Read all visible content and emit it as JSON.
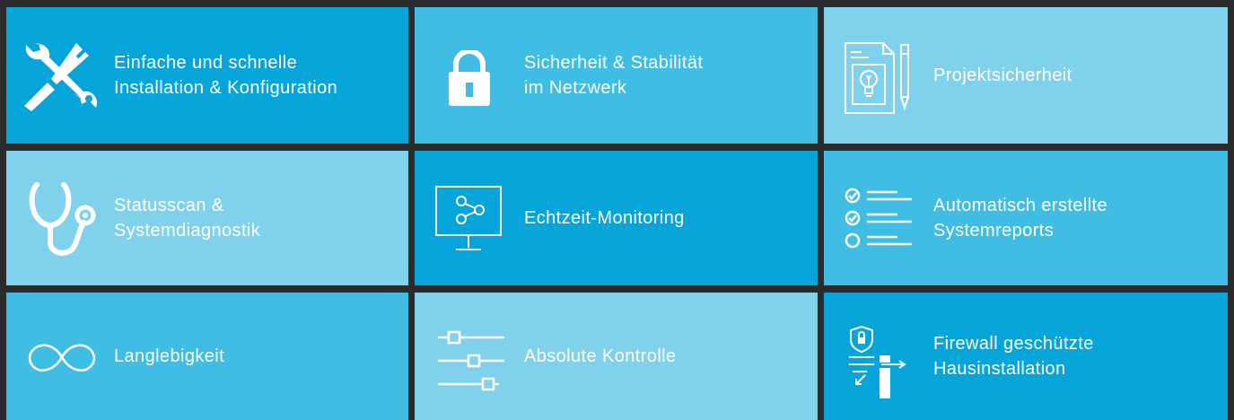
{
  "colors": {
    "background": "#2b2b2b",
    "tile_dark": "#05a4d9",
    "tile_mid": "#3fbde4",
    "tile_light": "#80d2ec",
    "text": "#ffffff"
  },
  "tiles": [
    {
      "icon": "tools-icon",
      "label": "Einfache und schnelle\nInstallation & Konfiguration",
      "tone": "dark"
    },
    {
      "icon": "padlock-icon",
      "label": "Sicherheit & Stabilität\nim Netzwerk",
      "tone": "mid"
    },
    {
      "icon": "project-document-icon",
      "label": "Projektsicherheit",
      "tone": "light"
    },
    {
      "icon": "stethoscope-icon",
      "label": "Statusscan &\nSystemdiagnostik",
      "tone": "light"
    },
    {
      "icon": "monitor-network-icon",
      "label": "Echtzeit-Monitoring",
      "tone": "dark"
    },
    {
      "icon": "checklist-icon",
      "label": "Automatisch erstellte\nSystemreports",
      "tone": "mid"
    },
    {
      "icon": "infinity-icon",
      "label": "Langlebigkeit",
      "tone": "mid"
    },
    {
      "icon": "sliders-icon",
      "label": "Absolute Kontrolle",
      "tone": "light"
    },
    {
      "icon": "firewall-icon",
      "label": "Firewall geschützte\nHausinstallation",
      "tone": "dark"
    }
  ]
}
